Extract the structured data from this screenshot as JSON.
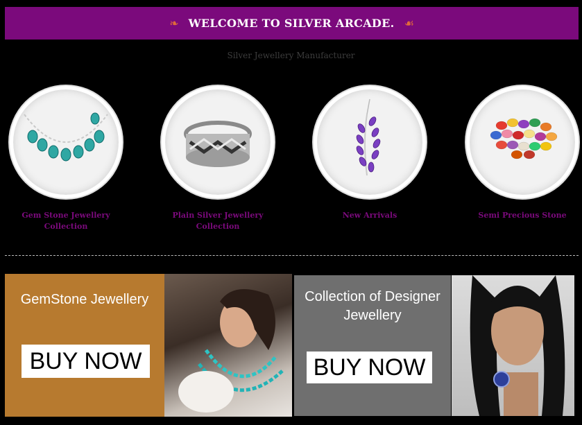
{
  "header": {
    "title": "WELCOME TO SILVER ARCADE.",
    "subtitle": "Silver Jewellery Manufacturer",
    "left_ornament": "ornament-swirl-icon",
    "right_ornament": "ornament-swirl-icon"
  },
  "categories": [
    {
      "label": "Gem Stone Jewellery Collection",
      "image": "gemstone-necklace-image"
    },
    {
      "label": "Plain Silver Jewellery Collection",
      "image": "silver-ring-image"
    },
    {
      "label": "New Arrivals",
      "image": "amethyst-pendant-image"
    },
    {
      "label": "Semi Precious Stone",
      "image": "colored-stones-image"
    }
  ],
  "promos": [
    {
      "title": "GemStone Jewellery",
      "button": "BUY NOW",
      "bg": "#b77a2f",
      "model": "model-turquoise-necklace-image"
    },
    {
      "title": "Collection of Designer Jewellery",
      "button": "BUY NOW",
      "bg": "#6f6f6f",
      "model": "model-blue-ring-image"
    }
  ],
  "colors": {
    "accent": "#7b0a7c",
    "background": "#000000",
    "ornament": "#e06a3a"
  }
}
